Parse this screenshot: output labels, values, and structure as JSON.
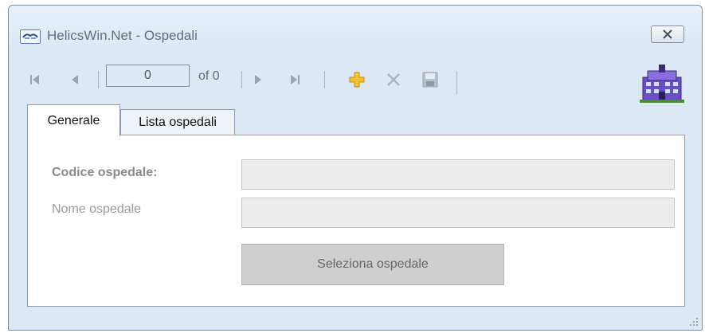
{
  "window": {
    "title": "HelicsWin.Net - Ospedali"
  },
  "navigator": {
    "position": "0",
    "of_label": "of 0"
  },
  "tabs": [
    {
      "label": "Generale",
      "active": true
    },
    {
      "label": "Lista ospedali",
      "active": false
    }
  ],
  "form": {
    "code_label": "Codice ospedale:",
    "code_value": "",
    "name_label": "Nome ospedale",
    "name_value": "",
    "select_button": "Seleziona ospedale"
  },
  "icons": {
    "app": "handshake-icon",
    "close": "close-icon",
    "first": "first-record-icon",
    "prev": "previous-record-icon",
    "next": "next-record-icon",
    "last": "last-record-icon",
    "add": "add-icon",
    "delete": "delete-icon",
    "save": "save-icon",
    "logo": "hospital-building-icon"
  },
  "colors": {
    "add_icon": "#f2c12e",
    "window_bg": "#dce9f5",
    "accent": "#5a3fa0"
  }
}
